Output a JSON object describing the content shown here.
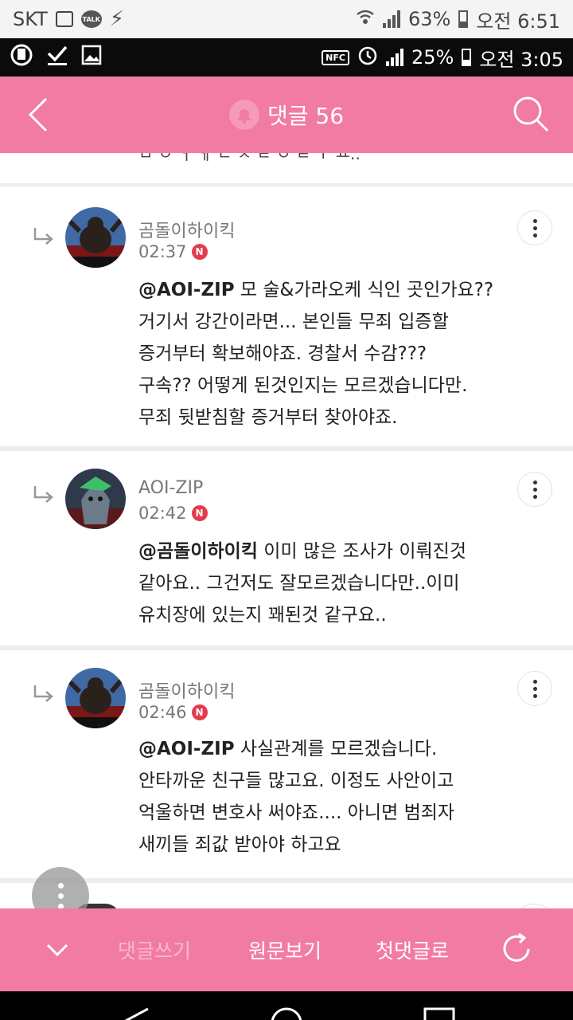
{
  "outer_status": {
    "carrier": "SKT",
    "talk_badge": "TALK",
    "battery": "63%",
    "time": "오전 6:51"
  },
  "inner_status": {
    "nfc": "NFC",
    "battery": "25%",
    "time": "오전 3:05"
  },
  "header": {
    "title": "댓글 56"
  },
  "top_clipped_text": "ㅁ ㅇ ㅓ ㅔ ㄴ ㅈ  ㅌ ㅇ ㄹ ㅜ ㅛ..",
  "comments": [
    {
      "author": "곰돌이하이킥",
      "time": "02:37",
      "badge": "N",
      "mention": "@AOI-ZIP",
      "text": "모 술&가라오케 식인 곳인가요??\n거기서 강간이라면... 본인들 무죄 입증할\n증거부터 확보해야죠. 경찰서 수감???\n구속?? 어떻게 된것인지는 모르겠습니다만.\n무죄 뒷받침할 증거부터 찾아야죠."
    },
    {
      "author": "AOI-ZIP",
      "time": "02:42",
      "badge": "N",
      "mention": "@곰돌이하이킥",
      "text": "이미 많은 조사가 이뤄진것\n같아요.. 그건저도 잘모르겠습니다만..이미\n유치장에 있는지 꽤된것 같구요.."
    },
    {
      "author": "곰돌이하이킥",
      "time": "02:46",
      "badge": "N",
      "mention": "@AOI-ZIP",
      "text": "사실관계를 모르겠습니다.\n안타까운 친구들 많고요. 이정도 사안이고\n억울하면 변호사 써야죠.... 아니면 범죄자\n새끼들 죄값 받아야 하고요"
    }
  ],
  "bottom_bar": {
    "write": "댓글쓰기",
    "original": "원문보기",
    "first": "첫댓글로"
  },
  "colors": {
    "accent": "#f27ba3",
    "badge": "#e63b4f"
  }
}
